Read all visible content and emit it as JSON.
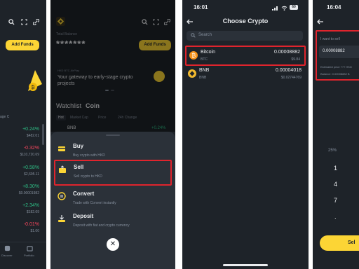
{
  "p1": {
    "add_funds": "Add Funds",
    "section_label": "age C",
    "changes": [
      "+0.24%",
      "-0.32%",
      "+0.58%",
      "+8.30%",
      "+2.34%",
      "-0.01%"
    ],
    "prices": [
      "$482.01",
      "$110,720.69",
      "$2,695.11",
      "$0.00001982",
      "$182.69",
      "$1.00"
    ],
    "nav": [
      "Discover",
      "Portfolio"
    ]
  },
  "p2": {
    "total_balance_label": "Total Balance",
    "balance_masked": "*******",
    "add_funds": "Add Funds",
    "promo_tag": "HKD BTC AirPlay",
    "promo_text": "Your gateway to early-stage crypto projects",
    "watchlist": "Watchlist",
    "coin": "Coin",
    "filters": [
      "Hot",
      "Market Cap",
      "Price",
      "24h Change"
    ],
    "partial_row": "BNB",
    "partial_change": "+0.24%",
    "menu": [
      {
        "title": "Buy",
        "sub": "Buy crypto with HKD"
      },
      {
        "title": "Sell",
        "sub": "Sell crypto to HKD"
      },
      {
        "title": "Convert",
        "sub": "Trade with Convert instantly"
      },
      {
        "title": "Deposit",
        "sub": "Deposit with fiat and crypto currency"
      }
    ],
    "close": "✕"
  },
  "p3": {
    "time": "16:01",
    "battery": "60",
    "title": "Choose Crypto",
    "search_placeholder": "Search",
    "coins": [
      {
        "name": "Bitcoin",
        "symbol": "BTC",
        "amount": "0.00008882",
        "fiat": "$9.84"
      },
      {
        "name": "BNB",
        "symbol": "BNB",
        "amount": "0.00004018",
        "fiat": "$0.02744769"
      }
    ]
  },
  "p4": {
    "time": "16:04",
    "want_to_sell": "I want to sell",
    "amount": "0.00008882",
    "est_price": "Estimated price ??? HKD",
    "balance": "Balance: 0.00008882 B",
    "pct": "25%",
    "keys": [
      "1",
      "4",
      "7",
      "."
    ],
    "sell_btn": "Sel"
  },
  "colors": {
    "bg": "#1e2329",
    "sheet": "#2b3139",
    "accent": "#fcd535",
    "green": "#2ebd85",
    "red": "#f6465d",
    "highlight": "#e0242d"
  }
}
